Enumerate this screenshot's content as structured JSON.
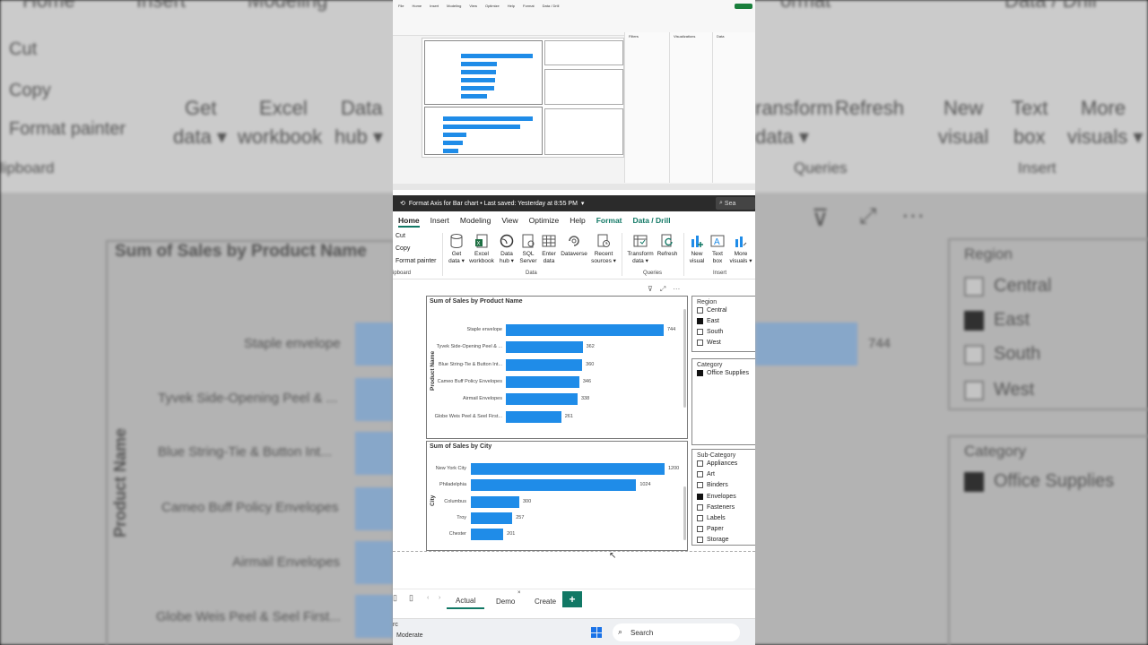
{
  "window": {
    "title": "Format Axis for Bar chart • Last saved: Yesterday at 8:55 PM",
    "search_label": "Sea"
  },
  "ribbon": {
    "tabs": [
      "Home",
      "Insert",
      "Modeling",
      "View",
      "Optimize",
      "Help",
      "Format",
      "Data / Drill"
    ],
    "active_tab": "Home",
    "clipboard": {
      "items": [
        "Cut",
        "Copy",
        "Format painter"
      ],
      "group_label": "Clipboard"
    },
    "data_group": {
      "buttons": [
        {
          "line1": "Get",
          "line2": "data ▾"
        },
        {
          "line1": "Excel",
          "line2": "workbook"
        },
        {
          "line1": "Data",
          "line2": "hub ▾"
        },
        {
          "line1": "SQL",
          "line2": "Server"
        },
        {
          "line1": "Enter",
          "line2": "data"
        },
        {
          "line1": "Dataverse",
          "line2": ""
        },
        {
          "line1": "Recent",
          "line2": "sources ▾"
        }
      ],
      "group_label": "Data"
    },
    "queries_group": {
      "buttons": [
        {
          "line1": "Transform",
          "line2": "data ▾"
        },
        {
          "line1": "Refresh",
          "line2": ""
        }
      ],
      "group_label": "Queries"
    },
    "insert_group": {
      "buttons": [
        {
          "line1": "New",
          "line2": "visual"
        },
        {
          "line1": "Text",
          "line2": "box"
        },
        {
          "line1": "More",
          "line2": "visuals ▾"
        }
      ],
      "group_label": "Insert"
    }
  },
  "visual_header_icons": [
    "filter-icon",
    "focus-mode-icon",
    "more-options-icon"
  ],
  "chart_data": [
    {
      "type": "bar",
      "title": "Sum of Sales by Product Name",
      "ylabel": "Product Name",
      "categories": [
        "Staple envelope",
        "Tyvek Side-Opening Peel & ...",
        "Blue String-Tie & Button Int...",
        "Cameo Buff Policy Envelopes",
        "Airmail Envelopes",
        "Globe Weis Peel & Seel First..."
      ],
      "values": [
        744,
        362,
        360,
        346,
        338,
        261
      ],
      "xlim": [
        0,
        744
      ]
    },
    {
      "type": "bar",
      "title": "Sum of Sales by City",
      "ylabel": "City",
      "categories": [
        "New York City",
        "Philadelphia",
        "Columbus",
        "Troy",
        "Chester"
      ],
      "values": [
        1200,
        1024,
        300,
        257,
        201
      ],
      "xlim": [
        0,
        1200
      ]
    }
  ],
  "slicers": {
    "region": {
      "title": "Region",
      "items": [
        {
          "label": "Central",
          "checked": false
        },
        {
          "label": "East",
          "checked": true
        },
        {
          "label": "South",
          "checked": false
        },
        {
          "label": "West",
          "checked": false
        }
      ]
    },
    "category": {
      "title": "Category",
      "items": [
        {
          "label": "Office Supplies",
          "checked": true
        }
      ]
    },
    "subcategory": {
      "title": "Sub-Category",
      "items": [
        {
          "label": "Appliances",
          "checked": false
        },
        {
          "label": "Art",
          "checked": false
        },
        {
          "label": "Binders",
          "checked": false
        },
        {
          "label": "Envelopes",
          "checked": true
        },
        {
          "label": "Fasteners",
          "checked": false
        },
        {
          "label": "Labels",
          "checked": false
        },
        {
          "label": "Paper",
          "checked": false
        },
        {
          "label": "Storage",
          "checked": false
        }
      ]
    }
  },
  "pages": {
    "tabs": [
      "Actual",
      "Demo",
      "Create"
    ],
    "active": "Actual",
    "add_label": "+"
  },
  "taskbar": {
    "weather": "Moderate",
    "search_label": "Search"
  },
  "background": {
    "ribbon_labels": [
      "Cut",
      "Copy",
      "Format painter",
      "lipboard",
      "Get",
      "data ▾",
      "Excel",
      "workbook",
      "Data",
      "hub ▾",
      "ransform",
      "data ▾",
      "Refresh",
      "Queries",
      "New",
      "visual",
      "Text",
      "box",
      "More",
      "visuals ▾",
      "Insert",
      "Home",
      "Insert",
      "Modeling",
      "ormat",
      "Data / Drill"
    ],
    "chart_title": "Sum of Sales by Product Name",
    "axis_label": "Product Name",
    "value_label": "744"
  },
  "mini": {
    "tabs": [
      "File",
      "Home",
      "Insert",
      "Modeling",
      "View",
      "Optimize",
      "Help",
      "Format",
      "Data / Drill"
    ],
    "panel_labels": [
      "Filters",
      "Visualizations",
      "Data"
    ]
  },
  "colors": {
    "bar": "#1f8ce8",
    "accent": "#117865"
  }
}
